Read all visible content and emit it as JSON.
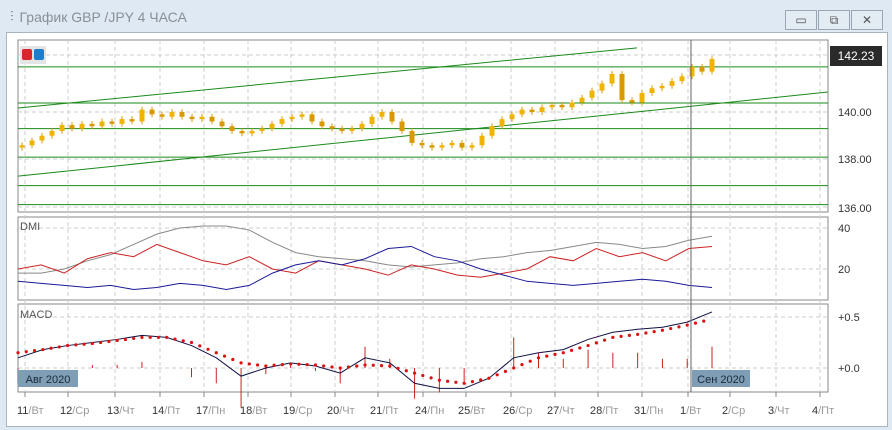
{
  "window": {
    "title": "График GBP /JPY  4 ЧАСА",
    "icons": [
      "chart-icon",
      "minimize-icon",
      "maximize-icon",
      "close-icon"
    ],
    "minimize": "▭",
    "maximize": "⧉",
    "close": "✕"
  },
  "price_panel": {
    "current_price": "142.23",
    "axis_labels": [
      "140.00",
      "138.00",
      "136.00"
    ]
  },
  "dmi_panel": {
    "label": "DMI",
    "axis_labels": [
      "40",
      "20"
    ]
  },
  "macd_panel": {
    "label": "MACD",
    "axis_labels": [
      "+0.5",
      "+0.0"
    ]
  },
  "month_labels": [
    "Авг 2020",
    "Сен 2020"
  ],
  "date_labels": [
    [
      "11",
      "Вт"
    ],
    [
      "12",
      "Ср"
    ],
    [
      "13",
      "Чт"
    ],
    [
      "14",
      "Пт"
    ],
    [
      "17",
      "Пн"
    ],
    [
      "18",
      "Вт"
    ],
    [
      "19",
      "Ср"
    ],
    [
      "20",
      "Чт"
    ],
    [
      "21",
      "Пт"
    ],
    [
      "24",
      "Пн"
    ],
    [
      "25",
      "Вт"
    ],
    [
      "26",
      "Ср"
    ],
    [
      "27",
      "Чт"
    ],
    [
      "28",
      "Пт"
    ],
    [
      "31",
      "Пн"
    ],
    [
      "1",
      "Вт"
    ],
    [
      "2",
      "Ср"
    ],
    [
      "3",
      "Чт"
    ],
    [
      "4",
      "Пт"
    ]
  ],
  "chart_data": {
    "type": "candlestick",
    "closes": [
      138.6,
      138.8,
      139.0,
      139.2,
      139.45,
      139.3,
      139.5,
      139.4,
      139.6,
      139.5,
      139.7,
      139.6,
      140.1,
      139.9,
      139.8,
      140.0,
      139.8,
      139.7,
      139.8,
      139.6,
      139.4,
      139.2,
      139.1,
      139.2,
      139.3,
      139.5,
      139.7,
      139.8,
      139.9,
      139.6,
      139.4,
      139.3,
      139.2,
      139.3,
      139.5,
      139.8,
      140.0,
      139.6,
      139.2,
      138.7,
      138.6,
      138.5,
      138.6,
      138.7,
      138.5,
      138.6,
      139.0,
      139.4,
      139.7,
      139.9,
      140.1,
      140.0,
      140.2,
      140.3,
      140.2,
      140.4,
      140.6,
      140.9,
      141.2,
      141.6,
      140.5,
      140.4,
      140.8,
      141.0,
      141.1,
      141.3,
      141.5,
      141.9,
      141.7,
      142.23
    ],
    "hlines": [
      141.9,
      140.38,
      139.3,
      138.1,
      136.9,
      136.1
    ],
    "trendlines": [
      [
        140.17,
        142.7
      ],
      [
        137.3,
        140.84
      ]
    ],
    "dmi": {
      "adx": [
        18,
        18,
        20,
        24,
        27,
        32,
        37,
        40,
        41,
        41,
        39,
        33,
        28,
        26,
        25,
        24,
        22,
        21,
        22,
        23,
        25,
        26,
        28,
        29,
        31,
        33,
        32,
        30,
        31,
        34,
        36
      ],
      "plus_di": [
        20,
        22,
        18,
        25,
        28,
        26,
        32,
        28,
        24,
        22,
        26,
        20,
        18,
        24,
        22,
        20,
        17,
        22,
        20,
        17,
        16,
        18,
        20,
        26,
        24,
        30,
        26,
        28,
        24,
        30,
        31
      ],
      "minus_di": [
        14,
        13,
        12,
        11,
        12,
        10,
        11,
        13,
        12,
        10,
        12,
        18,
        22,
        24,
        22,
        25,
        30,
        31,
        26,
        24,
        20,
        17,
        14,
        13,
        12,
        13,
        14,
        15,
        14,
        12,
        11
      ]
    },
    "macd": {
      "line": [
        0.1,
        0.18,
        0.22,
        0.25,
        0.28,
        0.32,
        0.3,
        0.22,
        0.1,
        -0.08,
        0,
        0.05,
        0.02,
        -0.05,
        0.1,
        0.05,
        -0.15,
        -0.2,
        -0.2,
        -0.1,
        0.1,
        0.15,
        0.18,
        0.28,
        0.35,
        0.38,
        0.4,
        0.45,
        0.55
      ],
      "signal": [
        0.15,
        0.18,
        0.22,
        0.24,
        0.27,
        0.3,
        0.3,
        0.25,
        0.15,
        0.05,
        0.02,
        0.04,
        0.03,
        0.0,
        0.03,
        0.02,
        -0.05,
        -0.12,
        -0.15,
        -0.1,
        0.0,
        0.1,
        0.15,
        0.22,
        0.3,
        0.33,
        0.37,
        0.42,
        0.48
      ]
    },
    "colors": {
      "bull": "#f0b400",
      "bear": "#d89a00",
      "lines": "#1a8a1a",
      "adx": "#888888",
      "plus_di": "#cc2222",
      "minus_di": "#1a1a99",
      "macd": "#111144",
      "signal": "#dd1111"
    }
  }
}
